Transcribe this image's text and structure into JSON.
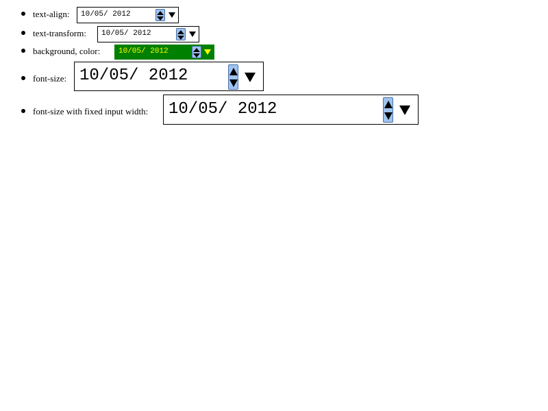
{
  "items": [
    {
      "label": "text-align:",
      "value": "10/05/ 2012"
    },
    {
      "label": "text-transform:",
      "value": "10/05/ 2012"
    },
    {
      "label": "background, color:",
      "value": "10/05/ 2012"
    },
    {
      "label": "font-size:",
      "value": "10/05/ 2012"
    },
    {
      "label": "font-size with fixed input width:",
      "value": "10/05/ 2012"
    }
  ],
  "colors": {
    "highlight_background": "#008000",
    "highlight_text": "#ffff00",
    "spin_button": "#9fc3f0"
  },
  "icons": {
    "spin": "up-down-arrows-icon",
    "picker": "dropdown-triangle-icon"
  }
}
